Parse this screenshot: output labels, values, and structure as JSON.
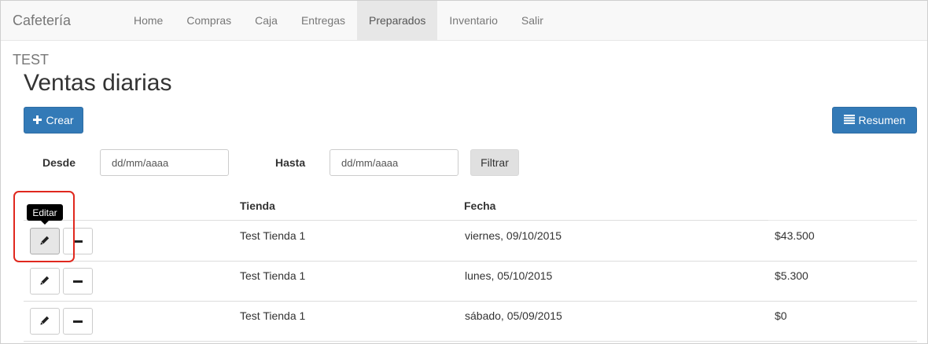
{
  "app": {
    "brand": "Cafetería TEST",
    "nav": [
      "Home",
      "Compras",
      "Caja",
      "Entregas",
      "Preparados",
      "Inventario",
      "Salir"
    ],
    "active_nav": "Preparados"
  },
  "page": {
    "title": "Ventas diarias",
    "crear_label": "Crear",
    "resumen_label": "Resumen"
  },
  "filter": {
    "desde_label": "Desde",
    "desde_placeholder": "dd/mm/aaaa",
    "hasta_label": "Hasta",
    "hasta_placeholder": "dd/mm/aaaa",
    "filtrar_label": "Filtrar"
  },
  "table": {
    "headers": {
      "tienda": "Tienda",
      "fecha": "Fecha",
      "monto": ""
    },
    "rows": [
      {
        "tienda": "Test Tienda 1",
        "fecha": "viernes, 09/10/2015",
        "monto": "$43.500"
      },
      {
        "tienda": "Test Tienda 1",
        "fecha": "lunes, 05/10/2015",
        "monto": "$5.300"
      },
      {
        "tienda": "Test Tienda 1",
        "fecha": "sábado, 05/09/2015",
        "monto": "$0"
      }
    ]
  },
  "tooltip": {
    "text": "Editar"
  },
  "icons": {
    "create": "plus-icon",
    "summary": "list-icon",
    "edit": "pencil-icon",
    "delete": "minus-icon"
  },
  "colors": {
    "primary": "#337ab7",
    "highlight": "#e0281e",
    "tooltip_bg": "#000000"
  }
}
